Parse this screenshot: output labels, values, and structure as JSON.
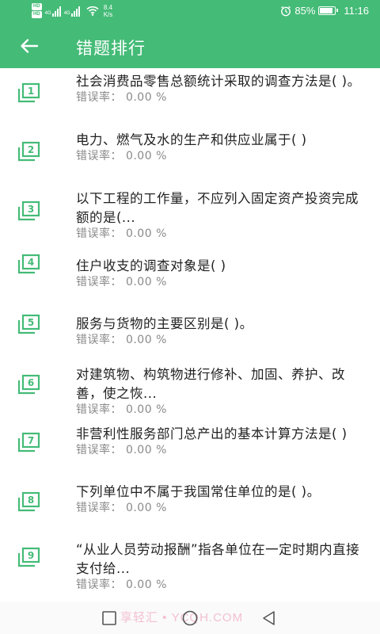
{
  "status_bar": {
    "hd_badges": [
      "HD",
      "HD"
    ],
    "network_types": [
      "4G",
      "4G"
    ],
    "speed_value": "8.4",
    "speed_unit": "K/s",
    "battery_percent": "85%",
    "time": "11:16",
    "battery_level": 0.85
  },
  "app_bar": {
    "title": "错题排行",
    "back_icon": "arrow-left-icon"
  },
  "colors": {
    "primary": "#44bb77",
    "text_primary": "#222222",
    "text_secondary": "#8a8a8a"
  },
  "items": [
    {
      "index": "1",
      "question": "社会消费品零售总额统计采取的调查方法是(  )。",
      "rate": "错误率：  0.00 %"
    },
    {
      "index": "2",
      "question": "电力、燃气及水的生产和供应业属于(  )",
      "rate": "错误率：  0.00 %"
    },
    {
      "index": "3",
      "question": "以下工程的工作量，不应列入固定资产投资完成额的是(...",
      "rate": "错误率：  0.00 %"
    },
    {
      "index": "4",
      "question": "住户收支的调查对象是(  )",
      "rate": "错误率：  0.00 %"
    },
    {
      "index": "5",
      "question": "服务与货物的主要区别是(  )。",
      "rate": "错误率：  0.00 %"
    },
    {
      "index": "6",
      "question": "对建筑物、构筑物进行修补、加固、养护、改善，使之恢...",
      "rate": "错误率：  0.00 %"
    },
    {
      "index": "7",
      "question": "非营利性服务部门总产出的基本计算方法是(  )",
      "rate": "错误率：  0.00 %"
    },
    {
      "index": "8",
      "question": "下列单位中不属于我国常住单位的是(  )。",
      "rate": "错误率：  0.00 %"
    },
    {
      "index": "9",
      "question": "“从业人员劳动报酬”指各单位在一定时期内直接支付给...",
      "rate": "错误率：  0.00 %"
    }
  ],
  "nav_bar": {
    "watermark": "享轻汇 • YCQH.COM",
    "buttons": [
      "square-recents-icon",
      "circle-home-icon",
      "triangle-back-icon"
    ]
  }
}
